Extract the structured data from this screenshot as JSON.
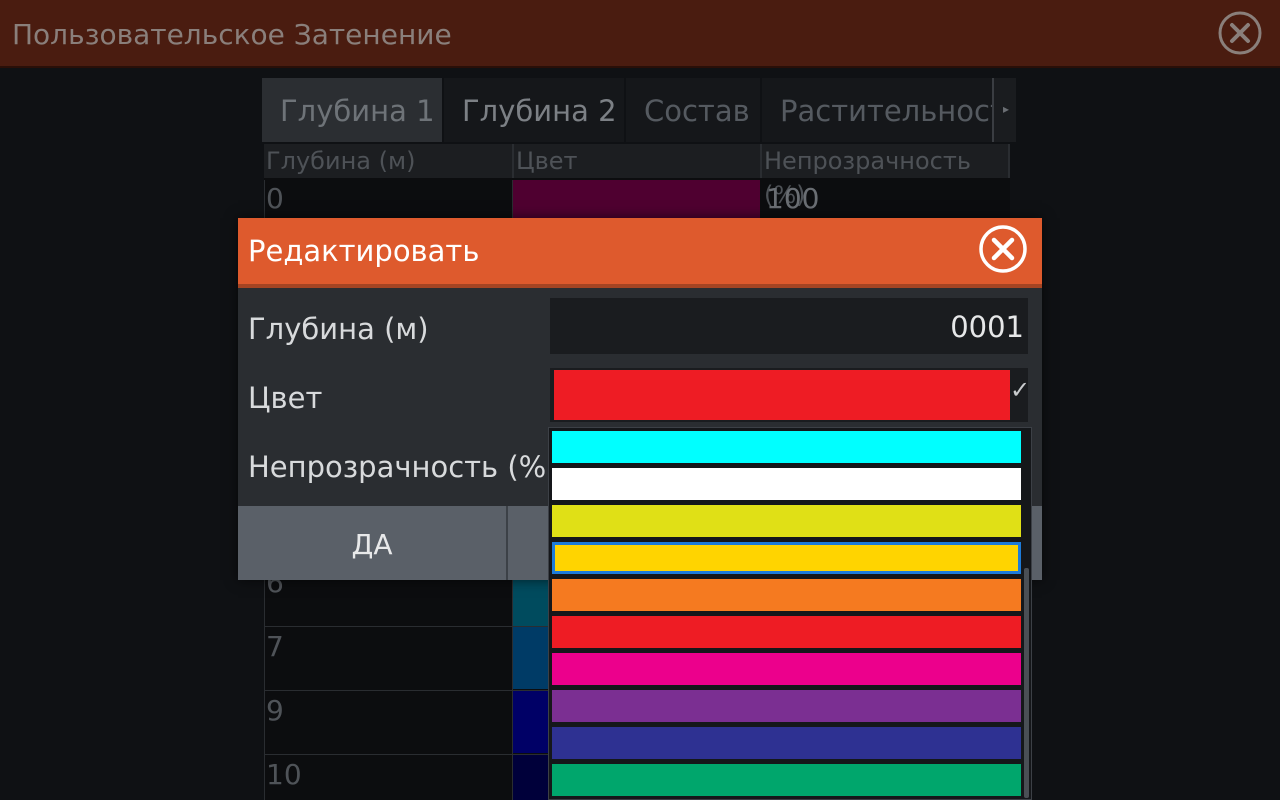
{
  "window": {
    "title": "Пользовательское Затенение",
    "close_icon": "close-icon"
  },
  "tabs": [
    {
      "label": "Глубина 1",
      "active": true
    },
    {
      "label": "Глубина 2",
      "active": false
    },
    {
      "label": "Состав",
      "active": false
    },
    {
      "label": "Растительность",
      "active": false
    }
  ],
  "table": {
    "headers": [
      "Глубина (м)",
      "Цвет",
      "Непрозрачность (%)"
    ],
    "rows": [
      {
        "depth": "0",
        "color": "#4f0030",
        "opacity": "100"
      },
      {
        "depth": "6",
        "color": "#004b5e",
        "opacity": ""
      },
      {
        "depth": "7",
        "color": "#003b66",
        "opacity": ""
      },
      {
        "depth": "9",
        "color": "#000066",
        "opacity": ""
      },
      {
        "depth": "10",
        "color": "#00003a",
        "opacity": ""
      }
    ]
  },
  "dialog": {
    "title": "Редактировать",
    "depth_label": "Глубина (м)",
    "depth_value": "0001",
    "color_label": "Цвет",
    "color_value": "#ee1c24",
    "opacity_label": "Непрозрачность (%)",
    "ok_label": "ДА"
  },
  "color_options": [
    {
      "color": "#00ffff",
      "selected": false
    },
    {
      "color": "#ffffff",
      "selected": false
    },
    {
      "color": "#e0e016",
      "selected": false
    },
    {
      "color": "#ffd400",
      "selected": true
    },
    {
      "color": "#f57a20",
      "selected": false
    },
    {
      "color": "#ee1c24",
      "selected": false
    },
    {
      "color": "#ec008c",
      "selected": false
    },
    {
      "color": "#7b2f92",
      "selected": false
    },
    {
      "color": "#2e3192",
      "selected": false
    },
    {
      "color": "#00a66c",
      "selected": false
    }
  ]
}
